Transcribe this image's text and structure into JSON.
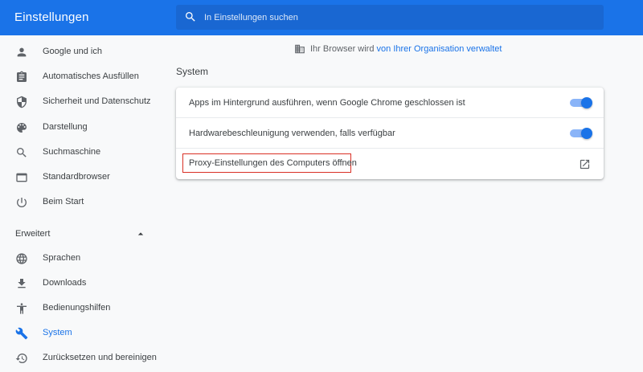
{
  "header": {
    "title": "Einstellungen",
    "search": {
      "placeholder": "In Einstellungen suchen",
      "icon": "search-icon"
    }
  },
  "sidebar": {
    "items": [
      {
        "label": "Google und ich",
        "icon": "person-icon"
      },
      {
        "label": "Automatisches Ausfüllen",
        "icon": "clipboard-icon"
      },
      {
        "label": "Sicherheit und Datenschutz",
        "icon": "shield-icon"
      },
      {
        "label": "Darstellung",
        "icon": "palette-icon"
      },
      {
        "label": "Suchmaschine",
        "icon": "search-icon"
      },
      {
        "label": "Standardbrowser",
        "icon": "browser-window-icon"
      },
      {
        "label": "Beim Start",
        "icon": "power-icon"
      }
    ],
    "advanced": {
      "label": "Erweitert",
      "expanded": true,
      "items": [
        {
          "label": "Sprachen",
          "icon": "globe-icon"
        },
        {
          "label": "Downloads",
          "icon": "download-icon"
        },
        {
          "label": "Bedienungshilfen",
          "icon": "accessibility-icon"
        },
        {
          "label": "System",
          "icon": "wrench-icon",
          "active": true
        },
        {
          "label": "Zurücksetzen und bereinigen",
          "icon": "restore-icon"
        }
      ]
    }
  },
  "managed_notice": {
    "prefix": "Ihr Browser wird ",
    "link": "von Ihrer Organisation verwaltet",
    "icon": "building-icon"
  },
  "main": {
    "section_title": "System",
    "rows": [
      {
        "label": "Apps im Hintergrund ausführen, wenn Google Chrome geschlossen ist",
        "toggle_on": true
      },
      {
        "label": "Hardwarebeschleunigung verwenden, falls verfügbar",
        "toggle_on": true
      },
      {
        "label": "Proxy-Einstellungen des Computers öffnen",
        "action_icon": "open-external-icon"
      }
    ]
  },
  "colors": {
    "accent": "#1a73e8",
    "header_bg": "#1a73e8",
    "highlight_border": "#d93025",
    "page_bg": "#f8f9fa"
  }
}
